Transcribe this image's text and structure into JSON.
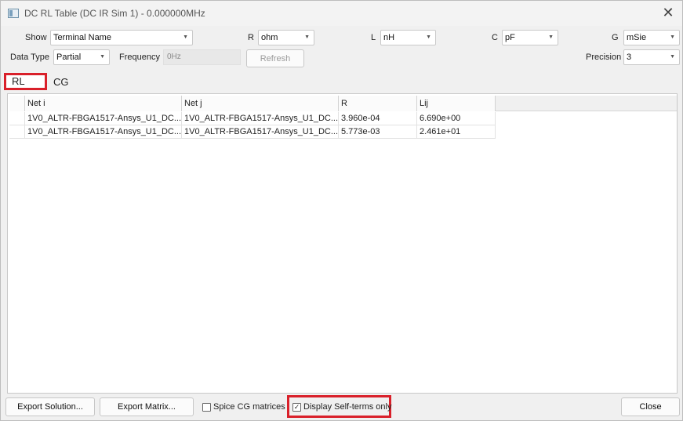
{
  "window": {
    "title": "DC RL Table (DC IR Sim 1)  -  0.000000MHz",
    "close_glyph": "✕"
  },
  "controls": {
    "show_label": "Show",
    "show_value": "Terminal Name",
    "r_label": "R",
    "r_value": "ohm",
    "l_label": "L",
    "l_value": "nH",
    "c_label": "C",
    "c_value": "pF",
    "g_label": "G",
    "g_value": "mSie",
    "data_type_label": "Data Type",
    "data_type_value": "Partial",
    "frequency_label": "Frequency",
    "frequency_value": "0Hz",
    "refresh_label": "Refresh",
    "precision_label": "Precision",
    "precision_value": "3",
    "arrow_glyph": "▼"
  },
  "tabs": [
    {
      "label": "RL",
      "active": true
    },
    {
      "label": "CG",
      "active": false
    }
  ],
  "table": {
    "columns": [
      "Net i",
      "Net j",
      "R",
      "Lij"
    ],
    "rows": [
      [
        "1V0_ALTR-FBGA1517-Ansys_U1_DC...",
        "1V0_ALTR-FBGA1517-Ansys_U1_DC...",
        "3.960e-04",
        "6.690e+00"
      ],
      [
        "1V0_ALTR-FBGA1517-Ansys_U1_DC...",
        "1V0_ALTR-FBGA1517-Ansys_U1_DC...",
        "5.773e-03",
        "2.461e+01"
      ]
    ]
  },
  "footer": {
    "export_solution": "Export Solution...",
    "export_matrix": "Export Matrix...",
    "spice_cg_label": "Spice CG matrices",
    "spice_cg_checked": false,
    "self_terms_label": "Display Self-terms only",
    "self_terms_checked": true,
    "check_glyph": "✓",
    "close": "Close"
  },
  "colors": {
    "highlight": "#d9202a",
    "background": "#f0f0f0"
  }
}
